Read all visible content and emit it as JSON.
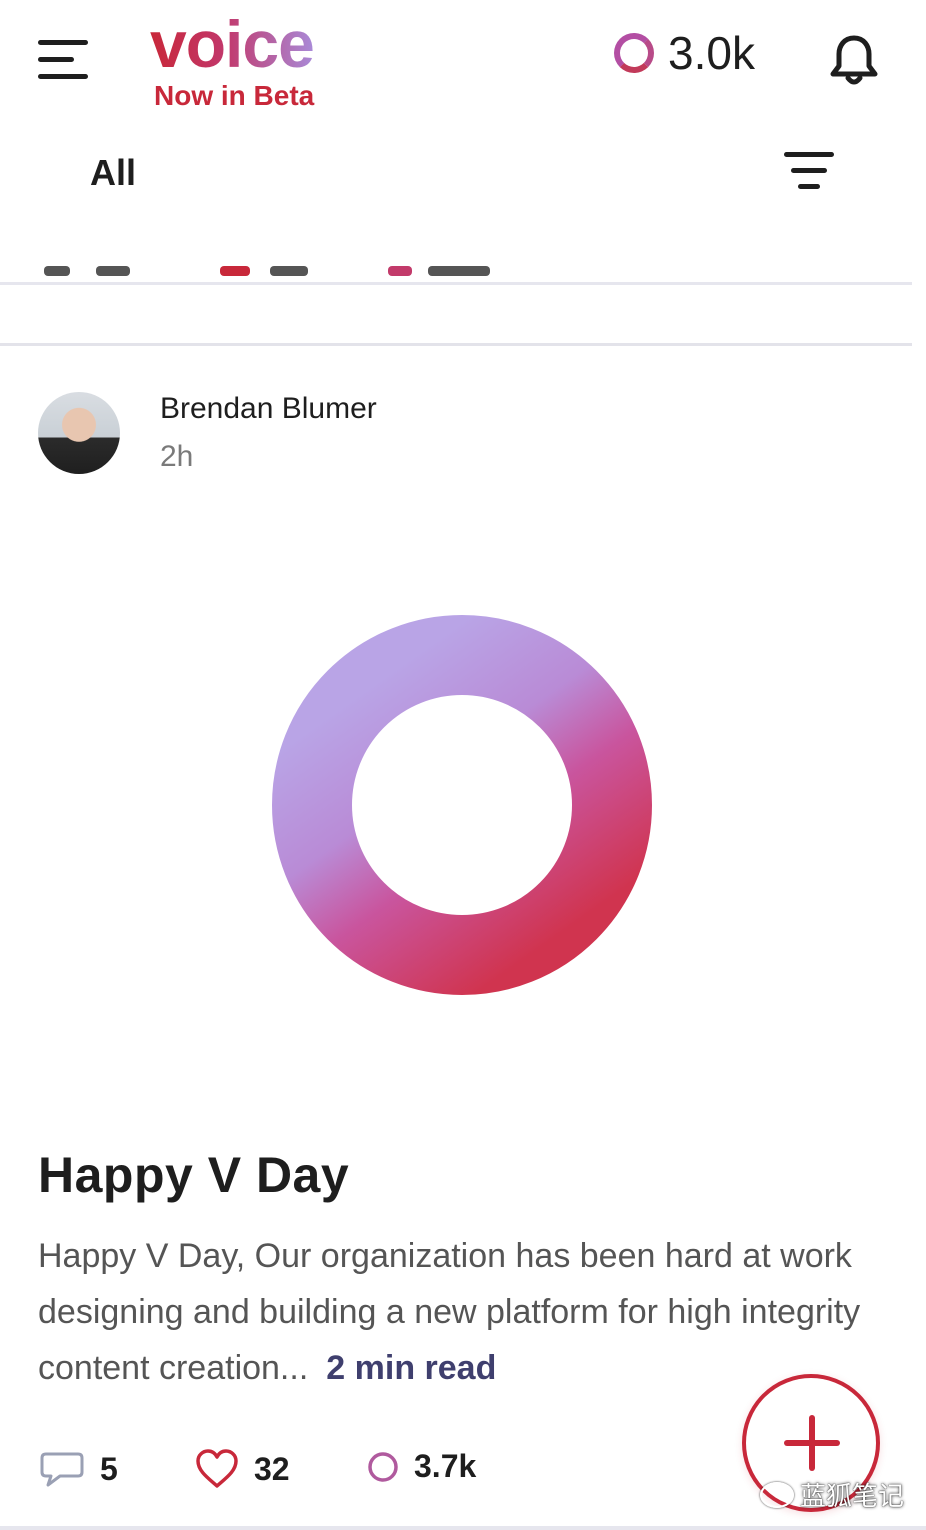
{
  "header": {
    "logo_text": "voice",
    "beta_label": "Now in Beta",
    "balance": "3.0k",
    "menu_icon": "hamburger-icon",
    "bell_icon": "bell-icon",
    "balance_icon": "voice-ring-icon"
  },
  "feed": {
    "tab_label": "All",
    "filter_icon": "filter-icon"
  },
  "post": {
    "author": "Brendan Blumer",
    "time": "2h",
    "title": "Happy V Day",
    "excerpt": "Happy V Day, Our organization has been hard at work designing and building a new platform for high integrity content creation...",
    "read_time": "2 min read",
    "stats": {
      "comments": "5",
      "likes": "32",
      "voice": "3.7k"
    }
  },
  "fab": {
    "icon": "plus-icon"
  },
  "watermark": {
    "text": "蓝狐笔记"
  },
  "colors": {
    "brand_red": "#c8283a",
    "brand_purple": "#a98ad8",
    "text_primary": "#1e1e1e",
    "text_secondary": "#555555"
  }
}
